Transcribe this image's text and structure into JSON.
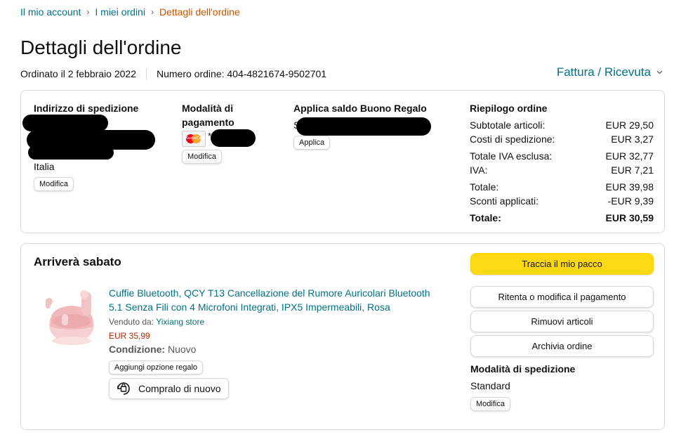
{
  "breadcrumb": {
    "items": [
      "Il mio account",
      "I miei ordini"
    ],
    "current": "Dettagli dell'ordine",
    "separator": "›"
  },
  "page": {
    "title": "Dettagli dell'ordine",
    "ordered_on": "Ordinato il 2 febbraio 2022",
    "order_number": "Numero ordine: 404-4821674-9502701",
    "invoice_label": "Fattura / Ricevuta",
    "invoice_icon": "chevron-down-icon"
  },
  "shipping_address": {
    "title": "Indirizzo di spedizione",
    "country": "Italia",
    "edit_label": "Modifica"
  },
  "payment": {
    "title": "Modalità di pagamento",
    "card_icon": "mastercard-icon",
    "card_prefix": "*",
    "card_brand_text": "MasterCard",
    "edit_label": "Modifica"
  },
  "gift_card": {
    "title": "Applica saldo Buono Regalo",
    "visible_char": "S",
    "apply_label": "Applica"
  },
  "summary": {
    "title": "Riepilogo ordine",
    "rows": [
      {
        "label": "Subtotale articoli:",
        "value": "EUR 29,50"
      },
      {
        "label": "Costi di spedizione:",
        "value": "EUR 3,27"
      },
      {
        "label": "Totale IVA esclusa:",
        "value": "EUR 32,77"
      },
      {
        "label": "IVA:",
        "value": "EUR 7,21"
      },
      {
        "label": "Totale:",
        "value": "EUR 39,98"
      },
      {
        "label": "Sconti applicati:",
        "value": "-EUR 9,39"
      }
    ],
    "grand_total": {
      "label": "Totale:",
      "value": "EUR 30,59"
    }
  },
  "shipment": {
    "arrival": "Arriverà sabato",
    "product": {
      "title": "Cuffie Bluetooth, QCY T13 Cancellazione del Rumore Auricolari Bluetooth 5.1 Senza Fili con 4 Microfoni Integrati, IPX5 Impermeabili, Rosa",
      "sold_by_label": "Venduto da:",
      "seller": "Yixiang store",
      "price": "EUR 35,99",
      "condition_label": "Condizione:",
      "condition_value": "Nuovo",
      "gift_label": "Aggiungi opzione regalo",
      "buy_again_label": "Compralo di nuovo",
      "buy_again_icon": "buy-again-icon",
      "image_icon": "pink-earbuds-image"
    },
    "actions": {
      "track": "Traccia il mio pacco",
      "retry_payment": "Ritenta o modifica il pagamento",
      "remove_items": "Rimuovi articoli",
      "archive": "Archivia ordine"
    },
    "shipping_method": {
      "title": "Modalità di spedizione",
      "value": "Standard",
      "edit_label": "Modifica"
    }
  },
  "colors": {
    "link": "#007185",
    "breadcrumb_current": "#c45500",
    "price": "#b12704",
    "primary_button": "#ffd814",
    "border": "#d5d9d9"
  }
}
